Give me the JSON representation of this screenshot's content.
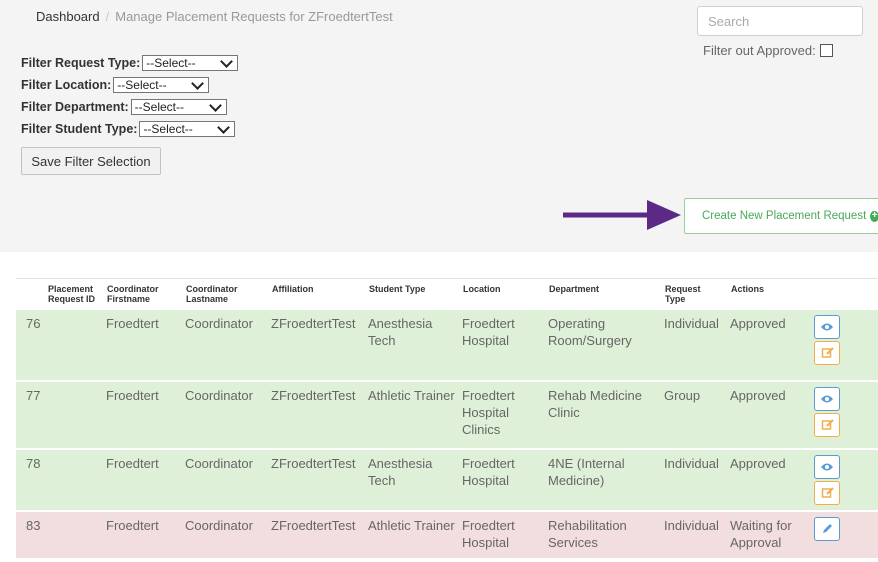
{
  "breadcrumb": {
    "home": "Dashboard",
    "current": "Manage Placement Requests for ZFroedtertTest"
  },
  "search": {
    "placeholder": "Search"
  },
  "filter_approved": {
    "label": "Filter out Approved:",
    "checked": false
  },
  "filters": [
    {
      "label": "Filter Request Type:",
      "value": "--Select--"
    },
    {
      "label": "Filter Location:",
      "value": "--Select--"
    },
    {
      "label": "Filter Department:",
      "value": "--Select--"
    },
    {
      "label": "Filter Student Type:",
      "value": "--Select--"
    }
  ],
  "save_filter_label": "Save Filter Selection",
  "create_button_label": "Create New Placement Request",
  "table": {
    "headers": {
      "id": "Placement Request ID",
      "first": "Coordinator Firstname",
      "last": "Coordinator Lastname",
      "affiliation": "Affiliation",
      "student_type": "Student Type",
      "location": "Location",
      "department": "Department",
      "request_type": "Request Type",
      "actions": "Actions"
    },
    "rows": [
      {
        "id": "76",
        "first": "Froedtert",
        "last": "Coordinator",
        "affiliation": "ZFroedtertTest",
        "student_type": "Anesthesia Tech",
        "location": "Froedtert Hospital",
        "department": "Operating Room/Surgery",
        "request_type": "Individual",
        "status": "Approved"
      },
      {
        "id": "77",
        "first": "Froedtert",
        "last": "Coordinator",
        "affiliation": "ZFroedtertTest",
        "student_type": "Athletic Trainer",
        "location": "Froedtert Hospital Clinics",
        "department": "Rehab Medicine Clinic",
        "request_type": "Group",
        "status": "Approved"
      },
      {
        "id": "78",
        "first": "Froedtert",
        "last": "Coordinator",
        "affiliation": "ZFroedtertTest",
        "student_type": "Anesthesia Tech",
        "location": "Froedtert Hospital",
        "department": "4NE (Internal Medicine)",
        "request_type": "Individual",
        "status": "Approved"
      },
      {
        "id": "83",
        "first": "Froedtert",
        "last": "Coordinator",
        "affiliation": "ZFroedtertTest",
        "student_type": "Athletic Trainer",
        "location": "Froedtert Hospital",
        "department": "Rehabilitation Services",
        "request_type": "Individual",
        "status": "Waiting for Approval"
      }
    ]
  },
  "colors": {
    "approved_row": "#dff0d8",
    "waiting_row": "#f2dede",
    "create_button": "#49a85a",
    "annotation_arrow": "#5b2a86",
    "view_button": "#5b9bd5",
    "edit_button": "#f0ad4e"
  },
  "icons": [
    "chevron-down-icon",
    "plus-circle-icon",
    "eye-icon",
    "edit-icon",
    "pencil-icon",
    "arrow-right-icon"
  ]
}
